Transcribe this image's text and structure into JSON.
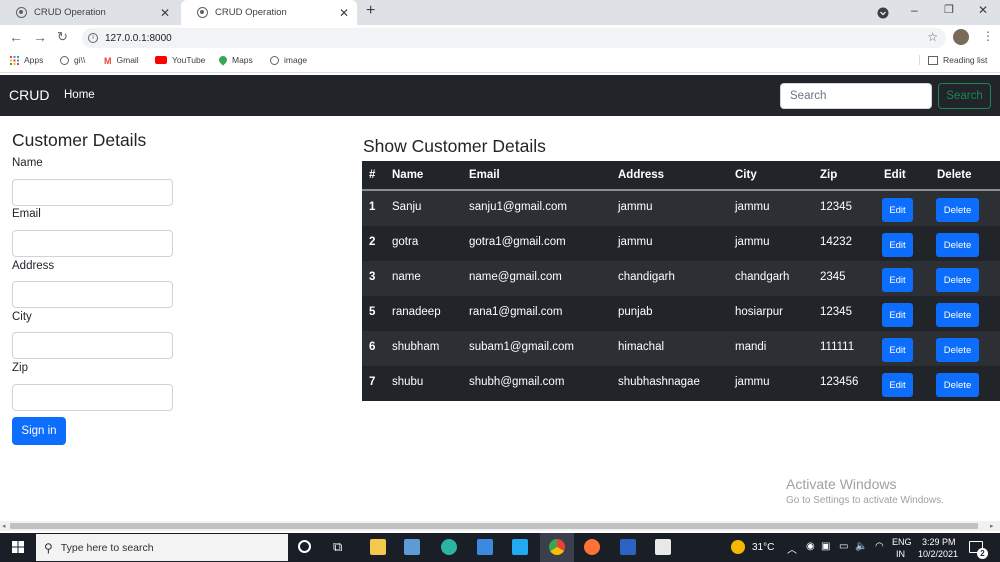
{
  "browser": {
    "tabs": [
      {
        "title": "CRUD Operation",
        "active": false
      },
      {
        "title": "CRUD Operation",
        "active": true
      }
    ],
    "url": "127.0.0.1:8000",
    "bookmarks": [
      "Apps",
      "gi\\\\",
      "Gmail",
      "YouTube",
      "Maps",
      "image"
    ],
    "reading_list": "Reading list"
  },
  "navbar": {
    "brand": "CRUD",
    "home": "Home",
    "search_placeholder": "Search",
    "search_button": "Search"
  },
  "form": {
    "title": "Customer Details",
    "labels": [
      "Name",
      "Email",
      "Address",
      "City",
      "Zip"
    ],
    "submit": "Sign in"
  },
  "table": {
    "title": "Show Customer Details",
    "headers": [
      "#",
      "Name",
      "Email",
      "Address",
      "City",
      "Zip",
      "Edit",
      "Delete"
    ],
    "rows": [
      {
        "id": "1",
        "name": "Sanju",
        "email": "sanju1@gmail.com",
        "address": "jammu",
        "city": "jammu",
        "zip": "12345"
      },
      {
        "id": "2",
        "name": "gotra",
        "email": "gotra1@gmail.com",
        "address": "jammu",
        "city": "jammu",
        "zip": "14232"
      },
      {
        "id": "3",
        "name": "name",
        "email": "name@gmail.com",
        "address": "chandigarh",
        "city": "chandgarh",
        "zip": "2345"
      },
      {
        "id": "5",
        "name": "ranadeep",
        "email": "rana1@gmail.com",
        "address": "punjab",
        "city": "hosiarpur",
        "zip": "12345"
      },
      {
        "id": "6",
        "name": "shubham",
        "email": "subam1@gmail.com",
        "address": "himachal",
        "city": "mandi",
        "zip": "111111"
      },
      {
        "id": "7",
        "name": "shubu",
        "email": "shubh@gmail.com",
        "address": "shubhashnagae",
        "city": "jammu",
        "zip": "123456"
      }
    ],
    "edit_label": "Edit",
    "delete_label": "Delete"
  },
  "watermark": {
    "line1": "Activate Windows",
    "line2": "Go to Settings to activate Windows."
  },
  "taskbar": {
    "search_placeholder": "Type here to search",
    "weather": "31°C",
    "lang1": "ENG",
    "lang2": "IN",
    "time": "3:29 PM",
    "date": "10/2/2021",
    "notifications": "2"
  }
}
